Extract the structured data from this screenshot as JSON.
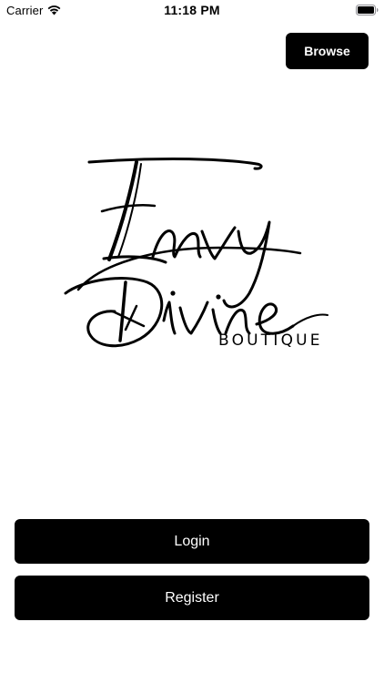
{
  "status_bar": {
    "carrier": "Carrier",
    "time": "11:18 PM",
    "wifi_icon": "wifi-icon",
    "battery_icon": "battery-full-icon"
  },
  "header": {
    "browse_label": "Browse"
  },
  "logo": {
    "name": "Envy Divine",
    "tagline": "BOUTIQUE"
  },
  "actions": {
    "login_label": "Login",
    "register_label": "Register"
  },
  "colors": {
    "background": "#ffffff",
    "button": "#000000",
    "button_text": "#ffffff"
  }
}
